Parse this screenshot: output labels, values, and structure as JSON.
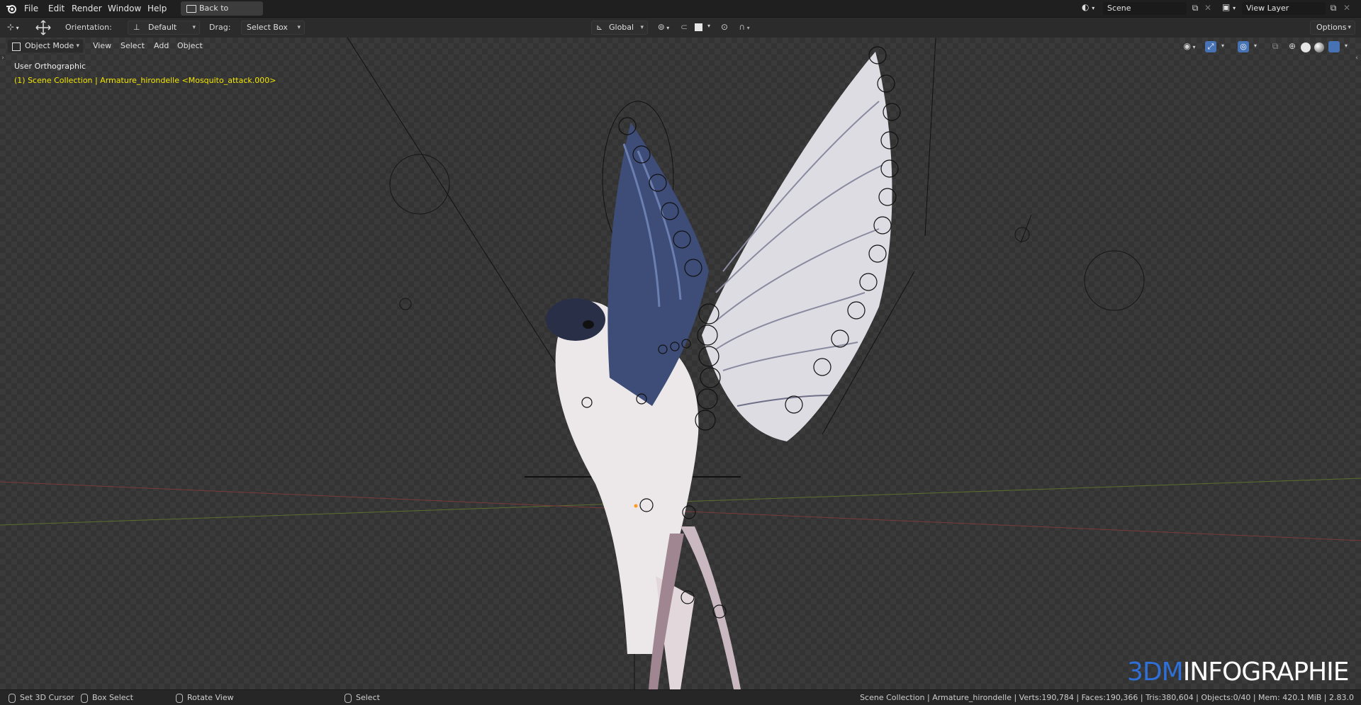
{
  "topbar": {
    "menu": [
      "File",
      "Edit",
      "Render",
      "Window",
      "Help"
    ],
    "back_button": "Back to Previous",
    "scene_name": "Scene",
    "view_layer_name": "View Layer"
  },
  "toolbar": {
    "orientation_label": "Orientation:",
    "orientation_value": "Default",
    "drag_label": "Drag:",
    "drag_value": "Select Box",
    "transform_space": "Global",
    "options_label": "Options"
  },
  "viewport_header": {
    "mode": "Object Mode",
    "menu": [
      "View",
      "Select",
      "Add",
      "Object"
    ]
  },
  "viewport": {
    "view_name": "User Orthographic",
    "collection_info": "(1) Scene Collection | Armature_hirondelle <Mosquito_attack.000>",
    "watermark_part1": "3DM",
    "watermark_part2": "INFOGRAPHIE",
    "colors": {
      "info_text": "#f2e600",
      "watermark_blue": "#2f6fd8",
      "watermark_white": "#ffffff",
      "active_blue": "#4772b3"
    }
  },
  "statusbar": {
    "items": [
      "Set 3D Cursor",
      "Box Select",
      "Rotate View",
      "Select"
    ],
    "stats": "Scene Collection | Armature_hirondelle | Verts:190,784 | Faces:190,366 | Tris:380,604 | Objects:0/40 | Mem: 420.1 MiB | 2.83.0"
  }
}
